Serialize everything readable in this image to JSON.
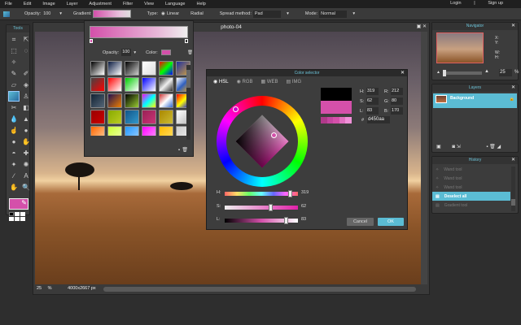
{
  "menu": {
    "items": [
      "File",
      "Edit",
      "Image",
      "Layer",
      "Adjustment",
      "Filter",
      "View",
      "Language",
      "Help"
    ],
    "login": "Login",
    "separator": "|",
    "signup": "Sign up"
  },
  "toolbar": {
    "opacity_label": "Opacity:",
    "opacity_value": "100",
    "gradient_label": "Gradient:",
    "type_label": "Type:",
    "type_linear": "Linear",
    "type_radial": "Radial",
    "spread_label": "Spread method:",
    "spread_value": "Pad",
    "mode_label": "Mode:",
    "mode_value": "Normal"
  },
  "tools": {
    "title": "Tools",
    "icons": [
      "crop",
      "move",
      "marquee",
      "lasso",
      "wand",
      "pencil",
      "brush",
      "eraser",
      "paint-bucket",
      "gradient",
      "stamp",
      "color-replace",
      "drawing",
      "blur",
      "sharpen",
      "smudge",
      "sponge",
      "dodge",
      "burn",
      "red-eye",
      "spot-heal",
      "bloat",
      "pinch",
      "color-picker",
      "type",
      "hand",
      "zoom"
    ],
    "primary_color": "#d450aa"
  },
  "canvas": {
    "title": "photo-04",
    "zoom": "25",
    "percent": "%",
    "dimensions": "4000x2667 px"
  },
  "gradient_popup": {
    "opacity_label": "Opacity:",
    "opacity_value": "100",
    "color_label": "Color:",
    "color": "#d450aa",
    "presets": [
      [
        "#000",
        "#fff"
      ],
      [
        "#0a1a40",
        "#fff"
      ],
      [
        "#000",
        "#ccc"
      ],
      [
        "#fff",
        "#ddd"
      ],
      [
        "#f00",
        "#0f0",
        "#00f"
      ],
      [
        "#2030a0",
        "#d0a040"
      ],
      [
        "#444",
        "#f00"
      ],
      [
        "#f00",
        "#fff"
      ],
      [
        "#0c0",
        "#fff"
      ],
      [
        "#00f",
        "#fff"
      ],
      [
        "#333",
        "#eee",
        "#333"
      ],
      [
        "#fff",
        "#3060c0",
        "#e0a020"
      ],
      [
        "#123",
        "#567"
      ],
      [
        "#201050",
        "#f08000"
      ],
      [
        "#000",
        "#9c3"
      ],
      [
        "#f0f",
        "#0ff",
        "#ff0"
      ],
      [
        "#c33",
        "#fff",
        "#36c"
      ],
      [
        "#f00",
        "#ff0",
        "#00f"
      ],
      [
        "#900",
        "#c00"
      ],
      [
        "#8a0",
        "#bc2"
      ],
      [
        "#158",
        "#39c"
      ],
      [
        "#925",
        "#c37"
      ],
      [
        "#a80",
        "#cb3"
      ],
      [
        "#fff",
        "#bbb"
      ],
      [
        "#f60",
        "#fc9"
      ],
      [
        "#cf3",
        "#efa"
      ],
      [
        "#29f",
        "#9cf"
      ],
      [
        "#f0f",
        "#f9f"
      ],
      [
        "#fb0",
        "#fd6"
      ],
      [
        "#ccc",
        "#eee"
      ]
    ]
  },
  "color_selector": {
    "title": "Color selector",
    "tabs": [
      "HSL",
      "RGB",
      "WEB",
      "IMG"
    ],
    "active_tab": "HSL",
    "H": "319",
    "S": "62",
    "L": "83",
    "R": "212",
    "G": "80",
    "B": "170",
    "hex_label": "#",
    "hex": "d450aa",
    "labels": {
      "h": "H:",
      "s": "S:",
      "l": "L:",
      "r": "R:",
      "g": "G:",
      "b": "B:"
    },
    "h_fraction": 0.89,
    "s_fraction": 0.62,
    "l_fraction": 0.83,
    "old_color": "#000000",
    "new_color": "#d450aa",
    "shades": [
      "#b03a8a",
      "#c446a0",
      "#d450aa",
      "#e070c0",
      "#f090d8"
    ],
    "cancel": "Cancel",
    "ok": "OK"
  },
  "navigator": {
    "title": "Navigator",
    "x": "X:",
    "y": "Y:",
    "w": "W:",
    "h": "H:",
    "zoom": "25",
    "percent": "%"
  },
  "layers": {
    "title": "Layers",
    "items": [
      {
        "name": "Background",
        "selected": true,
        "locked": true
      }
    ]
  },
  "history": {
    "title": "History",
    "items": [
      {
        "label": "Wand tool",
        "selected": false
      },
      {
        "label": "Wand tool",
        "selected": false
      },
      {
        "label": "Wand tool",
        "selected": false
      },
      {
        "label": "Deselect all",
        "selected": true
      },
      {
        "label": "Gradient tool",
        "selected": false
      }
    ]
  },
  "accent": "#5bbcd4"
}
